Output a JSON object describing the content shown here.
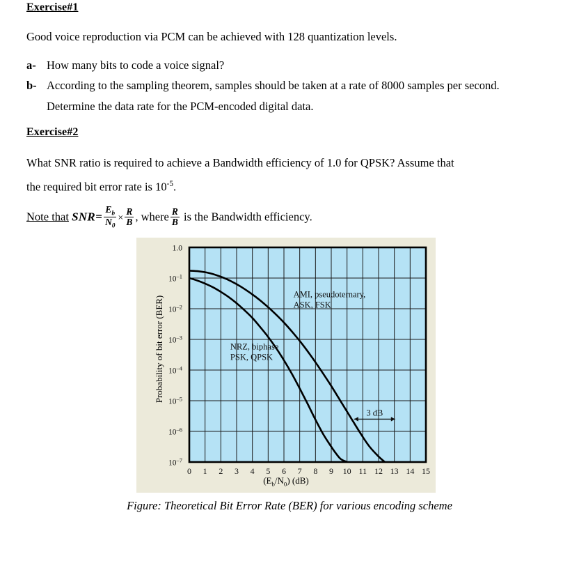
{
  "document": {
    "exercise1": {
      "heading": "Exercise#1",
      "intro": "Good voice reproduction via PCM can be achieved with 128 quantization levels.",
      "items": [
        {
          "marker": "a-",
          "text": "How many bits to code a voice signal?"
        },
        {
          "marker": "b-",
          "text": "According to the sampling theorem, samples should be taken at a rate of 8000 samples per second. Determine the data rate for the PCM-encoded digital data."
        }
      ]
    },
    "exercise2": {
      "heading": "Exercise#2",
      "question_line1": "What SNR ratio is required to achieve a Bandwidth efficiency of 1.0 for QPSK? Assume that",
      "question_line2_prefix": "the required bit error rate is 10",
      "question_line2_exponent": "-5",
      "question_line2_suffix": ".",
      "note": {
        "prefix": "Note that",
        "symbol": "SNR",
        "equals": "=",
        "frac1_num": "E",
        "frac1_num_sub": "b",
        "frac1_den": "N",
        "frac1_den_sub": "0",
        "times": "×",
        "frac2_num": "R",
        "frac2_den": "B",
        "mid": ", where",
        "frac3_num": "R",
        "frac3_den": "B",
        "tail": "is the Bandwidth efficiency."
      }
    },
    "caption": "Figure: Theoretical Bit Error Rate (BER) for various encoding scheme"
  },
  "chart_data": {
    "type": "line",
    "title": "",
    "xlabel": "(Eb/N0) (dB)",
    "ylabel": "Probability of bit error (BER)",
    "xlabel_parts": {
      "open": "(E",
      "sub1": "b",
      "slash": "/N",
      "sub2": "0",
      "close": ") (dB)"
    },
    "xlim": [
      0,
      15
    ],
    "ylim_log": [
      -7,
      0
    ],
    "xticks": [
      "0",
      "1",
      "2",
      "3",
      "4",
      "5",
      "6",
      "7",
      "8",
      "9",
      "10",
      "11",
      "12",
      "13",
      "14",
      "15"
    ],
    "yticks": [
      "1.0",
      "10–1",
      "10–2",
      "10–3",
      "10–4",
      "10–5",
      "10–6",
      "10–7"
    ],
    "ytick_exponents": [
      0,
      -1,
      -2,
      -3,
      -4,
      -5,
      -6,
      -7
    ],
    "grid": true,
    "legend_position": "inline-annotations",
    "plot_bg": "#b5e2f5",
    "panel_bg": "#eceada",
    "line_color": "#000000",
    "series": [
      {
        "name": "NRZ, biphase PSK, QPSK",
        "annotation_lines": [
          "NRZ, biphase",
          "PSK, QPSK"
        ],
        "points": [
          [
            0.0,
            -1.0
          ],
          [
            0.5,
            -1.08
          ],
          [
            1.0,
            -1.18
          ],
          [
            1.5,
            -1.3
          ],
          [
            2.0,
            -1.45
          ],
          [
            2.5,
            -1.62
          ],
          [
            3.0,
            -1.82
          ],
          [
            3.5,
            -2.05
          ],
          [
            4.0,
            -2.3
          ],
          [
            4.5,
            -2.6
          ],
          [
            5.0,
            -2.92
          ],
          [
            5.5,
            -3.28
          ],
          [
            6.0,
            -3.68
          ],
          [
            6.5,
            -4.12
          ],
          [
            7.0,
            -4.6
          ],
          [
            7.5,
            -5.1
          ],
          [
            8.0,
            -5.62
          ],
          [
            8.5,
            -6.1
          ],
          [
            9.0,
            -6.5
          ],
          [
            9.3,
            -6.72
          ],
          [
            9.6,
            -6.9
          ],
          [
            10.0,
            -7.0
          ]
        ]
      },
      {
        "name": "AMI, pseudoternary, ASK, FSK",
        "annotation_lines": [
          "AMI, pseudoternary,",
          "ASK, FSK"
        ],
        "points": [
          [
            0.0,
            -0.76
          ],
          [
            0.6,
            -0.78
          ],
          [
            1.2,
            -0.83
          ],
          [
            1.8,
            -0.92
          ],
          [
            2.4,
            -1.04
          ],
          [
            3.0,
            -1.2
          ],
          [
            3.6,
            -1.39
          ],
          [
            4.2,
            -1.61
          ],
          [
            4.8,
            -1.86
          ],
          [
            5.4,
            -2.14
          ],
          [
            6.0,
            -2.45
          ],
          [
            6.6,
            -2.8
          ],
          [
            7.2,
            -3.18
          ],
          [
            7.8,
            -3.6
          ],
          [
            8.4,
            -4.05
          ],
          [
            9.0,
            -4.52
          ],
          [
            9.6,
            -5.02
          ],
          [
            10.2,
            -5.52
          ],
          [
            10.8,
            -6.02
          ],
          [
            11.4,
            -6.48
          ],
          [
            12.0,
            -6.82
          ],
          [
            12.4,
            -7.0
          ]
        ]
      }
    ],
    "annotations": [
      {
        "name": "gap-label",
        "text": "3 dB",
        "x_start": 10.45,
        "x_end": 13.05,
        "y_log": -5.6,
        "style": "double-arrow"
      }
    ]
  }
}
